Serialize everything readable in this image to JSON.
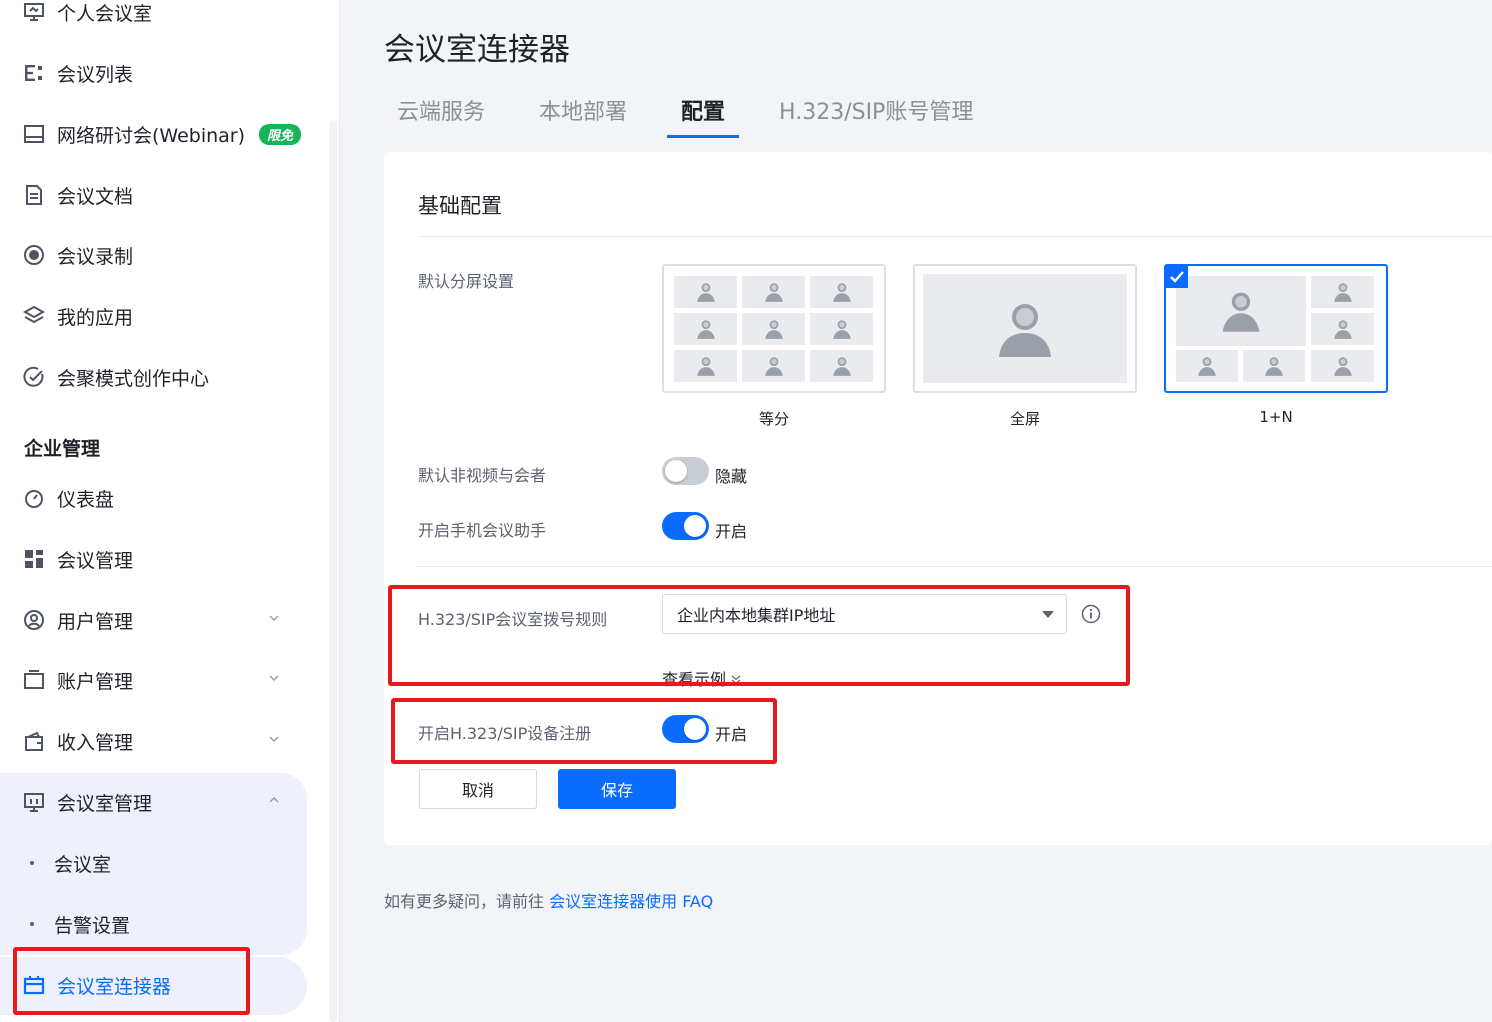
{
  "sidebar": {
    "items": [
      {
        "label": "个人会议室",
        "icon": "meeting-room-icon"
      },
      {
        "label": "会议列表",
        "icon": "list-icon"
      },
      {
        "label": "网络研讨会(Webinar)",
        "icon": "webinar-icon",
        "badge": "限免"
      },
      {
        "label": "会议文档",
        "icon": "document-icon"
      },
      {
        "label": "会议录制",
        "icon": "record-icon"
      },
      {
        "label": "我的应用",
        "icon": "apps-icon"
      },
      {
        "label": "会聚模式创作中心",
        "icon": "creation-center-icon"
      }
    ],
    "section_title": "企业管理",
    "admin_items": [
      {
        "label": "仪表盘",
        "icon": "dashboard-icon"
      },
      {
        "label": "会议管理",
        "icon": "grid-icon"
      },
      {
        "label": "用户管理",
        "icon": "user-icon"
      },
      {
        "label": "账户管理",
        "icon": "account-icon"
      },
      {
        "label": "收入管理",
        "icon": "wallet-icon"
      },
      {
        "label": "会议室管理",
        "icon": "room-manage-icon"
      }
    ],
    "sub_items": [
      {
        "label": "会议室"
      },
      {
        "label": "告警设置"
      }
    ],
    "active_item": {
      "label": "会议室连接器",
      "icon": "connector-icon"
    }
  },
  "main": {
    "title": "会议室连接器",
    "tabs": [
      {
        "label": "云端服务"
      },
      {
        "label": "本地部署"
      },
      {
        "label": "配置",
        "active": true
      },
      {
        "label": "H.323/SIP账号管理"
      }
    ],
    "card": {
      "title": "基础配置",
      "layout_label": "默认分屏设置",
      "layout_options": [
        {
          "caption": "等分",
          "selected": false
        },
        {
          "caption": "全屏",
          "selected": false
        },
        {
          "caption": "1+N",
          "selected": true
        }
      ],
      "non_video_label": "默认非视频与会者",
      "non_video_toggle": {
        "on": false,
        "text": "隐藏"
      },
      "assistant_label": "开启手机会议助手",
      "assistant_toggle": {
        "on": true,
        "text": "开启"
      },
      "dial_rule_label": "H.323/SIP会议室拨号规则",
      "dial_rule_value": "企业内本地集群IP地址",
      "example_link": "查看示例",
      "register_label": "开启H.323/SIP设备注册",
      "register_toggle": {
        "on": true,
        "text": "开启"
      },
      "cancel_label": "取消",
      "save_label": "保存"
    },
    "footer": {
      "text": "如有更多疑问，请前往",
      "link": "会议室连接器使用 FAQ"
    }
  },
  "colors": {
    "accent": "#0a6cff",
    "highlight_box": "#e8191d",
    "badge": "#19b35a"
  }
}
